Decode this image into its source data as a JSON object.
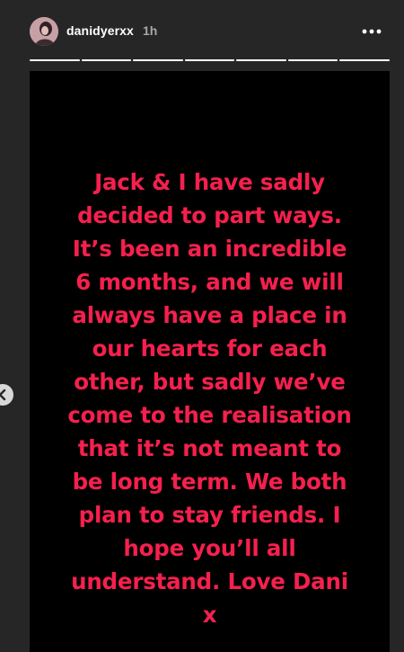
{
  "header": {
    "username": "danidyerxx",
    "time_ago": "1h",
    "more_icon": "more-horizontal-icon"
  },
  "progress": {
    "segment_count": 7,
    "segments_viewed": [
      1,
      1,
      1,
      1,
      1,
      1,
      1
    ]
  },
  "story": {
    "background_color": "#000000",
    "text_color": "#f5204d",
    "text": "Jack & I have sadly\ndecided to part ways.\nIt’s been an incredible\n6 months, and we will\nalways have a place in\nour hearts for each\nother, but sadly we’ve\ncome to the realisation\nthat it’s not meant to\nbe long term. We both\nplan to stay friends. I\nhope you’ll all\nunderstand. Love Dani\nx"
  },
  "navigation": {
    "prev_icon": "chevron-left-icon"
  }
}
